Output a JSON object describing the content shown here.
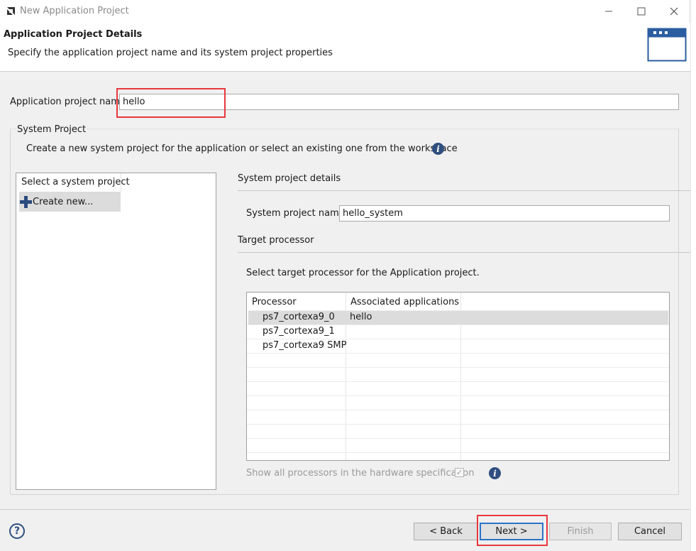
{
  "window": {
    "title": "New Application Project"
  },
  "banner": {
    "title": "Application Project Details",
    "subtitle": "Specify the application project name and its system project properties"
  },
  "app_name": {
    "label": "Application project name:",
    "value": "hello"
  },
  "system_project": {
    "group_title": "System Project",
    "description": "Create a new system project for the application or select an existing one from the workspace",
    "list_header": "Select a system project",
    "list_items": [
      "Create new..."
    ]
  },
  "details": {
    "title": "System project details",
    "name_label": "System project name:",
    "name_value": "hello_system",
    "target_title": "Target processor",
    "target_desc": "Select target processor for the Application project."
  },
  "processor_table": {
    "headers": [
      "Processor",
      "Associated applications"
    ],
    "rows": [
      [
        "ps7_cortexa9_0",
        "hello"
      ],
      [
        "ps7_cortexa9_1",
        ""
      ],
      [
        "ps7_cortexa9 SMP",
        ""
      ]
    ],
    "selected_row": 0
  },
  "show_all": {
    "label": "Show all processors in the hardware specification",
    "checked": true
  },
  "footer": {
    "help": "?",
    "back": "< Back",
    "next": "Next >",
    "finish": "Finish",
    "cancel": "Cancel"
  },
  "colors": {
    "highlight": "#e8383d",
    "accent": "#2f4f7f",
    "focus": "#2b73c9"
  }
}
